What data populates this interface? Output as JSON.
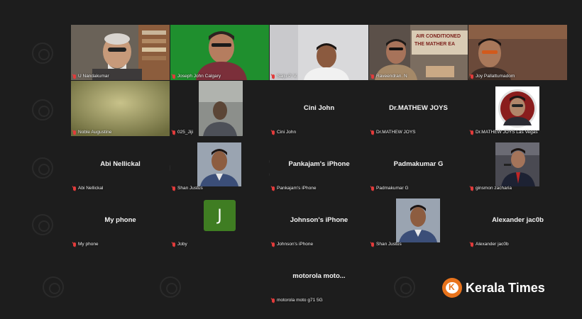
{
  "participants": [
    {
      "id": "unandakumar",
      "label": "U Nandakumar",
      "display": ""
    },
    {
      "id": "joseph",
      "label": "Joseph John Calgary",
      "display": ""
    },
    {
      "id": "saiju",
      "label": "Saiju P. V.",
      "display": ""
    },
    {
      "id": "raveendran",
      "label": "Raveendran. N",
      "display": ""
    },
    {
      "id": "joy",
      "label": "Joy Pallattumadom",
      "display": ""
    },
    {
      "id": "noble",
      "label": "Noble Augustine",
      "display": ""
    },
    {
      "id": "jiji",
      "label": "025_Jiji",
      "display": ""
    },
    {
      "id": "cini",
      "label": "Cini John",
      "display": "Cini John"
    },
    {
      "id": "mathew",
      "label": "Dr.MATHEW JOYS",
      "display": "Dr.MATHEW JOYS"
    },
    {
      "id": "mathew_lv",
      "label": "Dr.MATHEW JOYS Las Vegas",
      "display": ""
    },
    {
      "id": "abi",
      "label": "Abi Nellickal",
      "display": "Abi Nellickal"
    },
    {
      "id": "shan1",
      "label": "Shan Justus",
      "display": ""
    },
    {
      "id": "pankajam",
      "label": "Pankajam's iPhone",
      "display": "Pankajam's iPhone"
    },
    {
      "id": "padmakumar",
      "label": "Padmakumar G",
      "display": "Padmakumar G"
    },
    {
      "id": "ginsmon",
      "label": "ginsmon zacharia",
      "display": ""
    },
    {
      "id": "myphone",
      "label": "My phone",
      "display": "My phone"
    },
    {
      "id": "joby",
      "label": "Joby",
      "display": "",
      "initial": "J"
    },
    {
      "id": "johnson",
      "label": "Johnson's iPhone",
      "display": "Johnson's iPhone"
    },
    {
      "id": "shan2",
      "label": "Shan Justus",
      "display": ""
    },
    {
      "id": "alexander",
      "label": "Alexander jac0b",
      "display": "Alexander jac0b"
    },
    {
      "id": "motorola",
      "label": "motorola moto g71 5G",
      "display": "motorola  moto..."
    }
  ],
  "backdrop_sign": "AIR CONDITIONED",
  "backdrop_sign2": "THE MATHER EA",
  "brand": {
    "name": "Kerala Times",
    "logo": "kerala-times-logo"
  },
  "colors": {
    "background": "#1d1d1d",
    "avatar_green": "#3f7d22",
    "brand_orange": "#e8731c",
    "mic_red": "#e23b3b"
  }
}
